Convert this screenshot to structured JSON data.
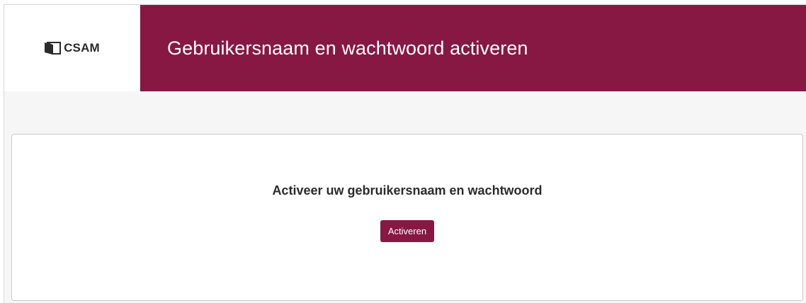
{
  "header": {
    "logo_text": "CSAM",
    "title": "Gebruikersnaam en wachtwoord activeren"
  },
  "main": {
    "heading": "Activeer uw gebruikersnaam en wachtwoord",
    "activate_button_label": "Activeren"
  },
  "colors": {
    "brand": "#861843",
    "page_background": "#f6f6f6"
  },
  "icons": {
    "logo": "csam-door-logo-icon"
  }
}
